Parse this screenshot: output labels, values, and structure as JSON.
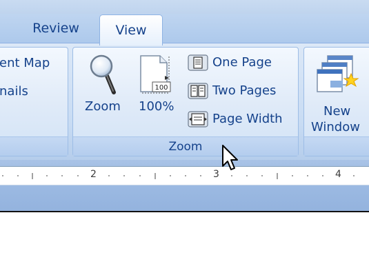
{
  "tabs": [
    {
      "label": "Review"
    },
    {
      "label": "View"
    }
  ],
  "left_group": {
    "items": [
      "ent Map",
      "nails"
    ]
  },
  "zoom_group": {
    "label": "Zoom",
    "zoom_label": "Zoom",
    "percent_label": "100%",
    "percent_icon_text": "100",
    "one_page_label": "One Page",
    "two_pages_label": "Two Pages",
    "page_width_label": "Page Width"
  },
  "window_group": {
    "new_window_line1": "New",
    "new_window_line2": "Window"
  },
  "ruler": {
    "numbers": [
      "2",
      "3",
      "4"
    ]
  }
}
